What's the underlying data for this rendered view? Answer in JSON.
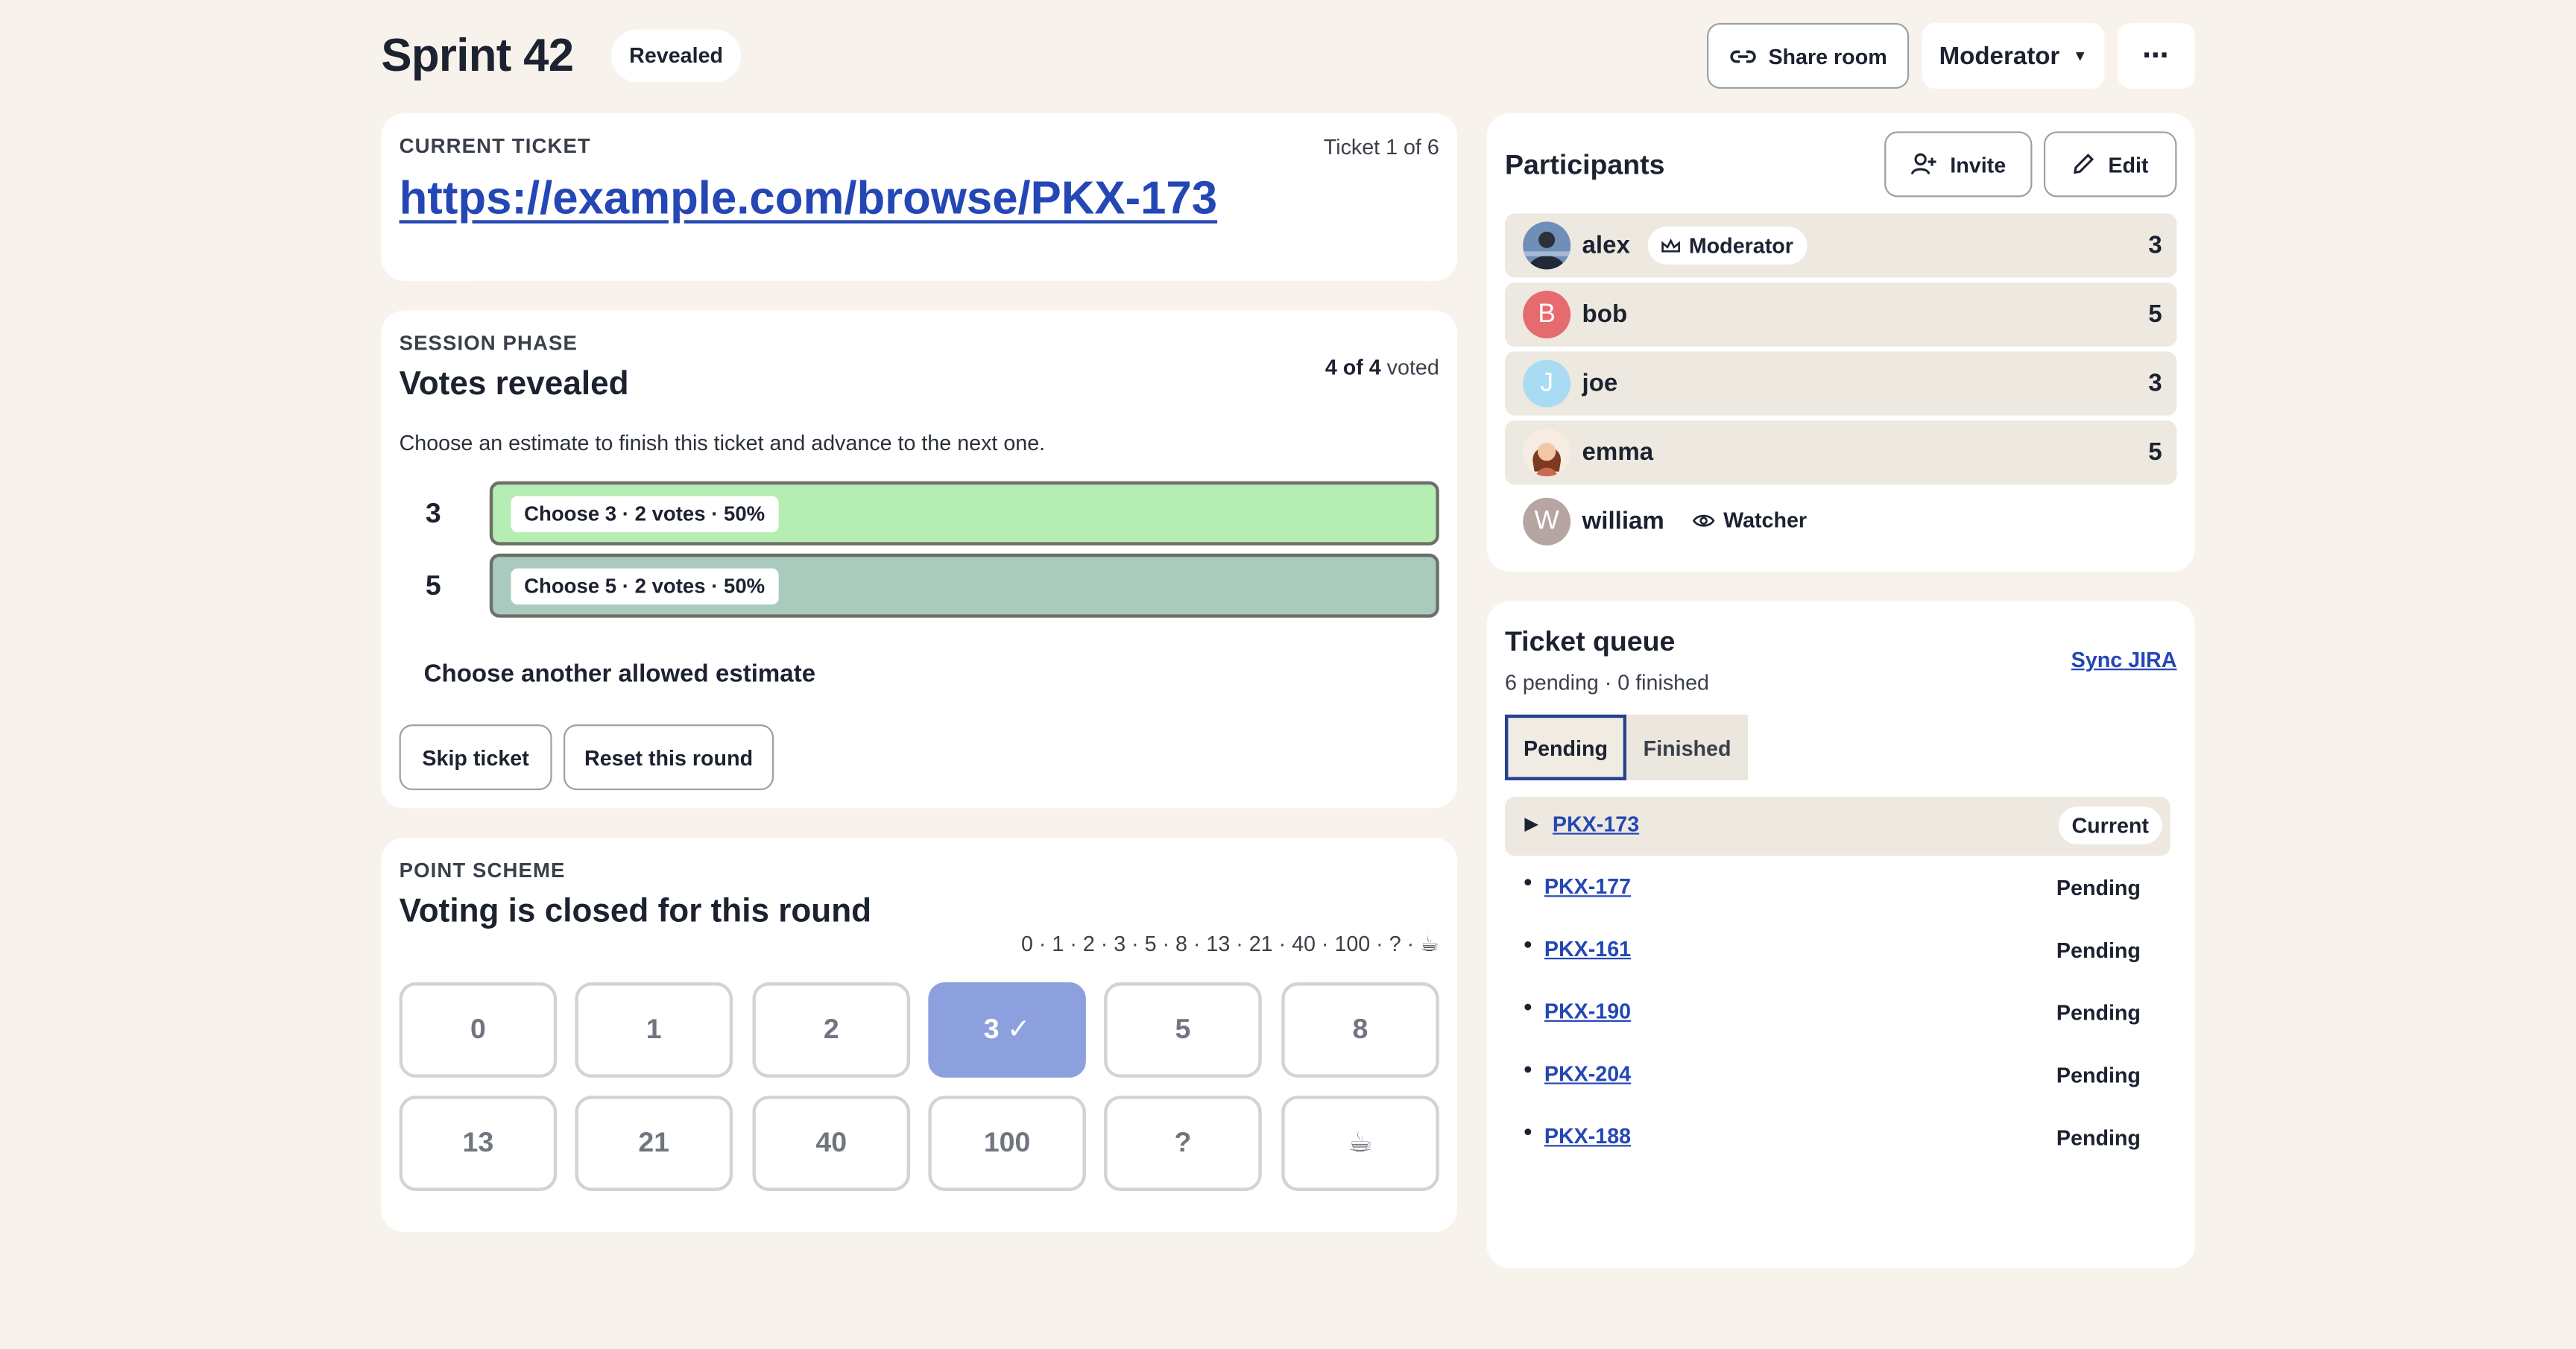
{
  "header": {
    "title": "Sprint 42",
    "status_badge": "Revealed",
    "share_label": "Share room",
    "role_label": "Moderator",
    "more_label": "⋯"
  },
  "ticket": {
    "eyebrow": "CURRENT TICKET",
    "position": "Ticket 1 of 6",
    "url": "https://example.com/browse/PKX-173"
  },
  "phase": {
    "eyebrow": "SESSION PHASE",
    "title": "Votes revealed",
    "voted_count": "4 of 4",
    "voted_suffix": " voted",
    "description": "Choose an estimate to finish this ticket and advance to the next one.",
    "estimates": [
      {
        "value": "3",
        "label": "Choose 3 · 2 votes · 50%",
        "percent": 50,
        "color": "#b5edb3"
      },
      {
        "value": "5",
        "label": "Choose 5 · 2 votes · 50%",
        "percent": 50,
        "color": "#a8cbbd"
      }
    ],
    "other_estimate": "Choose another allowed estimate",
    "skip_label": "Skip ticket",
    "reset_label": "Reset this round"
  },
  "scheme": {
    "eyebrow": "POINT SCHEME",
    "title": "Voting is closed for this round",
    "sequence": "0 · 1 · 2 · 3 · 5 · 8 · 13 · 21 · 40 · 100 · ? · ☕",
    "cards": [
      "0",
      "1",
      "2",
      "3 ✓",
      "5",
      "8",
      "13",
      "21",
      "40",
      "100",
      "?",
      "☕"
    ],
    "selected": "3 ✓"
  },
  "participants": {
    "title": "Participants",
    "invite_label": "Invite",
    "edit_label": "Edit",
    "people": [
      {
        "name": "alex",
        "initial": "",
        "tag": "Moderator",
        "vote": "3",
        "avatar_color": "#5b7fa8",
        "avatar_icon": "photo-avatar"
      },
      {
        "name": "bob",
        "initial": "B",
        "tag": "",
        "vote": "5",
        "avatar_color": "#e66b6e"
      },
      {
        "name": "joe",
        "initial": "J",
        "tag": "",
        "vote": "3",
        "avatar_color": "#a9dcf2"
      },
      {
        "name": "emma",
        "initial": "",
        "tag": "",
        "vote": "5",
        "avatar_color": "#f3e7dc",
        "avatar_icon": "illustrated-avatar"
      },
      {
        "name": "william",
        "initial": "W",
        "tag": "Watcher",
        "vote": "",
        "avatar_color": "#b7a5a3"
      }
    ]
  },
  "queue": {
    "title": "Ticket queue",
    "summary": "6 pending · 0 finished",
    "sync_label": "Sync JIRA",
    "tabs": [
      "Pending",
      "Finished"
    ],
    "active_tab": "Pending",
    "items": [
      {
        "key": "PKX-173",
        "status": "Current"
      },
      {
        "key": "PKX-177",
        "status": "Pending"
      },
      {
        "key": "PKX-161",
        "status": "Pending"
      },
      {
        "key": "PKX-190",
        "status": "Pending"
      },
      {
        "key": "PKX-204",
        "status": "Pending"
      },
      {
        "key": "PKX-188",
        "status": "Pending"
      }
    ]
  }
}
